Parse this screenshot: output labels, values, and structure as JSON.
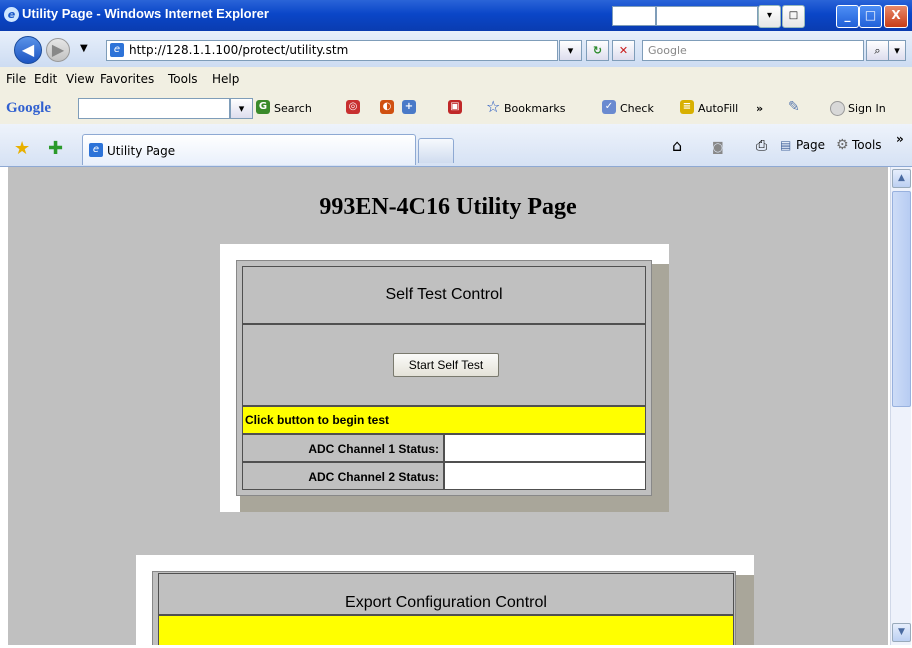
{
  "window": {
    "title": "Utility Page - Windows Internet Explorer",
    "minimize": "_",
    "maximize": "□",
    "close": "X"
  },
  "address": {
    "url": "http://128.1.1.100/protect/utility.stm",
    "search_placeholder": "Google"
  },
  "menu": [
    "File",
    "Edit",
    "View",
    "Favorites",
    "Tools",
    "Help"
  ],
  "google_toolbar": {
    "logo": "Google",
    "search": "Search",
    "bookmarks": "Bookmarks",
    "check": "Check",
    "autofill": "AutoFill",
    "more": "»",
    "sign_in": "Sign In"
  },
  "tabs": {
    "active_label": "Utility Page",
    "page_cmd": "Page",
    "tools_cmd": "Tools"
  },
  "page": {
    "title": "993EN-4C16 Utility Page",
    "self_test": {
      "header": "Self Test Control",
      "button": "Start Self Test",
      "status_message": "Click button to begin test",
      "adc1_label": "ADC Channel 1 Status:",
      "adc1_value": "",
      "adc2_label": "ADC Channel 2 Status:",
      "adc2_value": ""
    },
    "export": {
      "header": "Export Configuration Control"
    }
  },
  "colors": {
    "content_bg": "#c0c0c0",
    "status_highlight": "#ffff00",
    "titlebar": "#0a46c8"
  }
}
